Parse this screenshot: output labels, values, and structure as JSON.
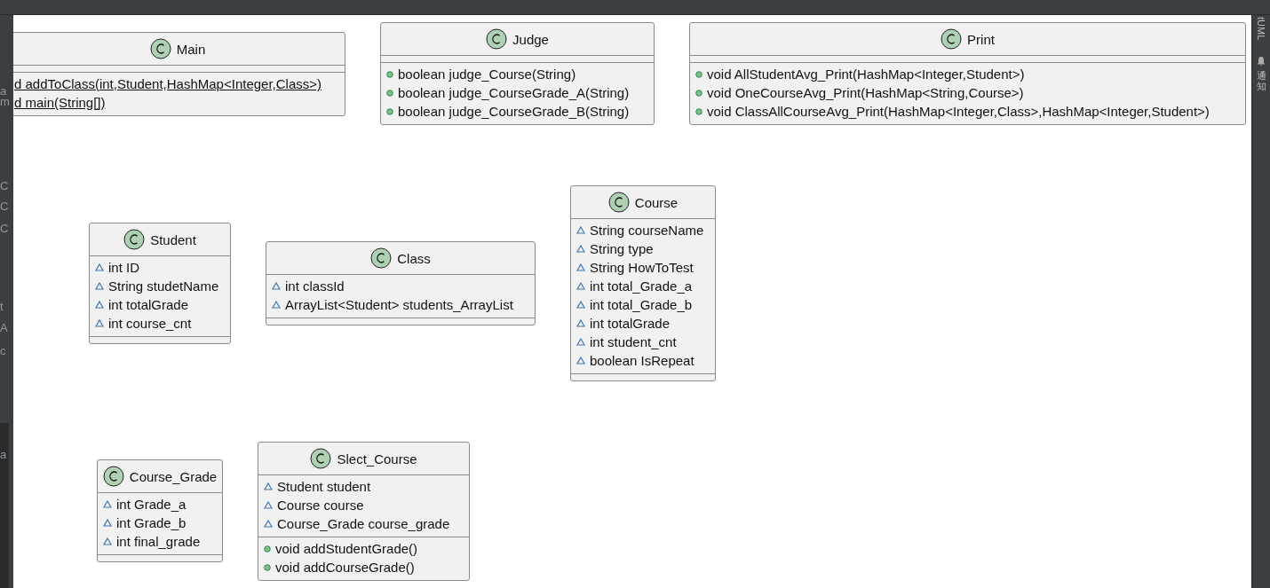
{
  "left_panel": {
    "fragments": [
      "a",
      "m",
      "C",
      "C",
      "C",
      "t",
      "A",
      "c",
      "a"
    ]
  },
  "right_panel": {
    "plugin_tab": "tUML",
    "notifications_tab": "通知"
  },
  "diagram": {
    "classes": [
      {
        "name": "Main",
        "methods": [
          {
            "static": true,
            "text": "d addToClass(int,Student,HashMap<Integer,Class>)"
          },
          {
            "static": true,
            "text": "d main(String[])"
          }
        ]
      },
      {
        "name": "Judge",
        "methods": [
          {
            "kind": "public",
            "static": false,
            "text": "boolean judge_Course(String)"
          },
          {
            "kind": "public",
            "static": false,
            "text": "boolean judge_CourseGrade_A(String)"
          },
          {
            "kind": "public",
            "static": false,
            "text": "boolean judge_CourseGrade_B(String)"
          }
        ]
      },
      {
        "name": "Print",
        "methods": [
          {
            "kind": "public",
            "static": false,
            "text": "void AllStudentAvg_Print(HashMap<Integer,Student>)"
          },
          {
            "kind": "public",
            "static": false,
            "text": "void OneCourseAvg_Print(HashMap<String,Course>)"
          },
          {
            "kind": "public",
            "static": false,
            "text": "void ClassAllCourseAvg_Print(HashMap<Integer,Class>,HashMap<Integer,Student>)"
          }
        ]
      },
      {
        "name": "Student",
        "fields": [
          {
            "kind": "package",
            "text": "int ID"
          },
          {
            "kind": "package",
            "text": "String studetName"
          },
          {
            "kind": "package",
            "text": "int totalGrade"
          },
          {
            "kind": "package",
            "text": "int course_cnt"
          }
        ]
      },
      {
        "name": "Class",
        "fields": [
          {
            "kind": "package",
            "text": "int classId"
          },
          {
            "kind": "package",
            "text": "ArrayList<Student> students_ArrayList"
          }
        ]
      },
      {
        "name": "Course",
        "fields": [
          {
            "kind": "package",
            "text": "String courseName"
          },
          {
            "kind": "package",
            "text": "String type"
          },
          {
            "kind": "package",
            "text": "String HowToTest"
          },
          {
            "kind": "package",
            "text": "int total_Grade_a"
          },
          {
            "kind": "package",
            "text": "int total_Grade_b"
          },
          {
            "kind": "package",
            "text": "int totalGrade"
          },
          {
            "kind": "package",
            "text": "int student_cnt"
          },
          {
            "kind": "package",
            "text": "boolean IsRepeat"
          }
        ]
      },
      {
        "name": "Course_Grade",
        "fields": [
          {
            "kind": "package",
            "text": "int Grade_a"
          },
          {
            "kind": "package",
            "text": "int Grade_b"
          },
          {
            "kind": "package",
            "text": "int final_grade"
          }
        ]
      },
      {
        "name": "Slect_Course",
        "fields": [
          {
            "kind": "package",
            "text": "Student student"
          },
          {
            "kind": "package",
            "text": "Course course"
          },
          {
            "kind": "package",
            "text": "Course_Grade course_grade"
          }
        ],
        "methods": [
          {
            "kind": "public",
            "static": false,
            "text": "void addStudentGrade()"
          },
          {
            "kind": "public",
            "static": false,
            "text": "void addCourseGrade()"
          }
        ]
      }
    ]
  }
}
